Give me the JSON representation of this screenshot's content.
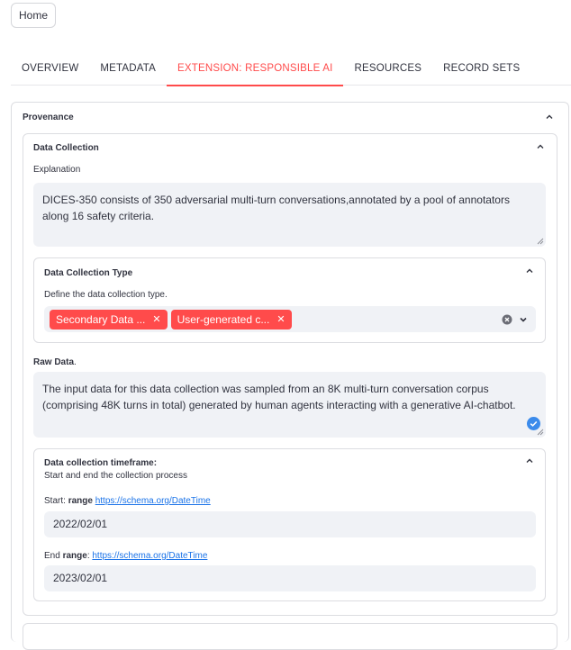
{
  "home_button": "Home",
  "tabs": [
    {
      "label": "OVERVIEW"
    },
    {
      "label": "METADATA"
    },
    {
      "label": "EXTENSION: RESPONSIBLE AI"
    },
    {
      "label": "RESOURCES"
    },
    {
      "label": "RECORD SETS"
    }
  ],
  "provenance": {
    "title": "Provenance",
    "data_collection": {
      "title": "Data Collection",
      "explanation_label": "Explanation",
      "explanation_value": "DICES-350 consists of 350 adversarial multi-turn conversations,annotated by a pool of annotators along 16 safety criteria.",
      "type_section": {
        "title": "Data Collection Type",
        "label": "Define the data collection type.",
        "tags": [
          "Secondary Data ...",
          "User-generated c..."
        ]
      },
      "raw_data_label": "Raw Data",
      "raw_data_suffix": ".",
      "raw_data_value": "The input data for this data collection was sampled from an 8K multi-turn conversation corpus (comprising 48K turns in total) generated by human agents interacting with a generative AI-chatbot.",
      "timeframe": {
        "title": "Data collection timeframe:",
        "subtitle": "Start and end the collection process",
        "start_prefix": "Start: ",
        "start_bold": "range",
        "start_link": "https://schema.org/DateTime",
        "start_value": "2022/02/01",
        "end_prefix": "End ",
        "end_bold": "range",
        "end_colon": ": ",
        "end_link": "https://schema.org/DateTime",
        "end_value": "2023/02/01"
      }
    }
  },
  "colors": {
    "accent": "#ff4b4b",
    "link": "#1a73e8",
    "field_bg": "#f0f2f6",
    "check": "#3b8beb"
  }
}
